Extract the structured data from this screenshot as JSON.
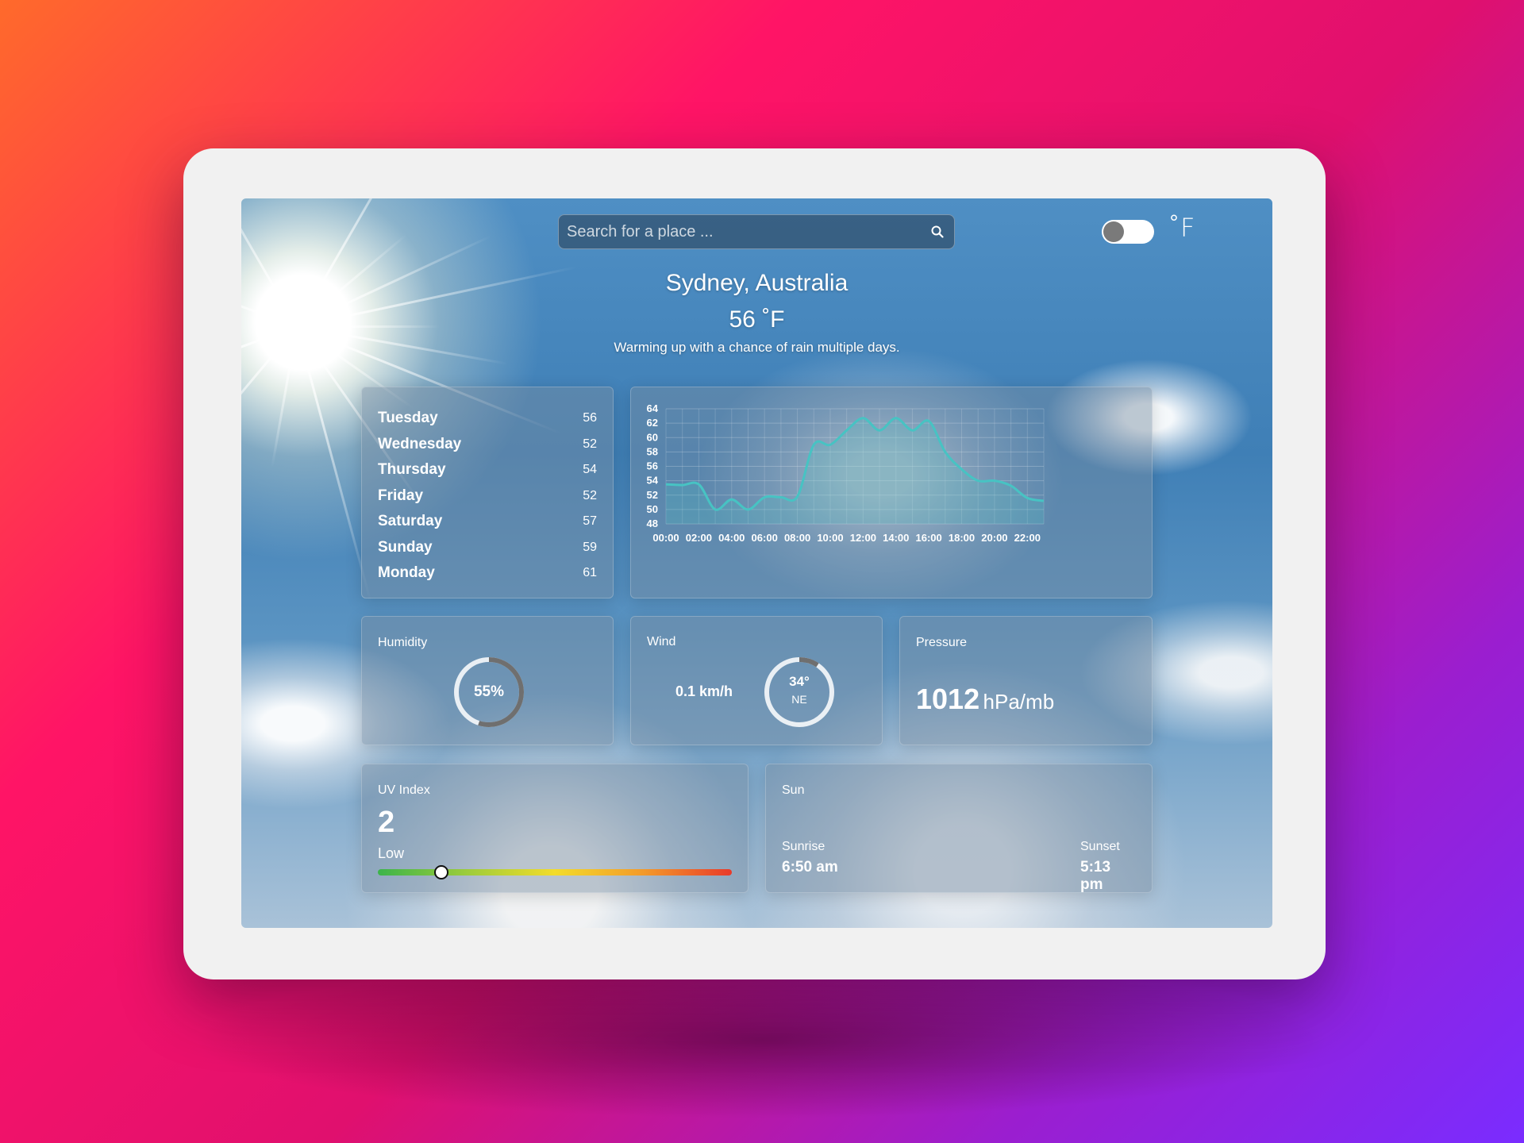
{
  "search": {
    "placeholder": "Search for a place ..."
  },
  "units": {
    "label": "˚F",
    "toggle_on": false
  },
  "location": {
    "city": "Sydney, Australia",
    "temp": "56",
    "temp_unit": "˚F",
    "description": "Warming up with a chance of rain multiple days."
  },
  "forecast": [
    {
      "day": "Tuesday",
      "temp": "56"
    },
    {
      "day": "Wednesday",
      "temp": "52"
    },
    {
      "day": "Thursday",
      "temp": "54"
    },
    {
      "day": "Friday",
      "temp": "52"
    },
    {
      "day": "Saturday",
      "temp": "57"
    },
    {
      "day": "Sunday",
      "temp": "59"
    },
    {
      "day": "Monday",
      "temp": "61"
    }
  ],
  "chart_data": {
    "type": "area",
    "x": [
      "00:00",
      "01:00",
      "02:00",
      "03:00",
      "04:00",
      "05:00",
      "06:00",
      "07:00",
      "08:00",
      "09:00",
      "10:00",
      "11:00",
      "12:00",
      "13:00",
      "14:00",
      "15:00",
      "16:00",
      "17:00",
      "18:00",
      "19:00",
      "20:00",
      "21:00",
      "22:00",
      "23:00"
    ],
    "x_ticks": [
      "00:00",
      "02:00",
      "04:00",
      "06:00",
      "08:00",
      "10:00",
      "12:00",
      "14:00",
      "16:00",
      "18:00",
      "20:00",
      "22:00"
    ],
    "values": [
      53.5,
      53.4,
      53.5,
      50,
      51.4,
      50,
      51.7,
      51.7,
      51.8,
      59,
      59,
      61,
      62.7,
      61,
      62.7,
      61,
      62.3,
      58,
      55.6,
      54,
      54,
      53.3,
      51.6,
      51.2
    ],
    "ylim": [
      48,
      64
    ],
    "y_ticks": [
      48,
      50,
      52,
      54,
      56,
      58,
      60,
      62,
      64
    ],
    "grid": true,
    "line_color": "#47c3c3",
    "fill_color": "#47c3c3"
  },
  "humidity": {
    "label": "Humidity",
    "value": "55%",
    "fraction": 0.55
  },
  "wind": {
    "label": "Wind",
    "speed": "0.1 km/h",
    "degrees": "34°",
    "direction": "NE",
    "deg_value": 34
  },
  "pressure": {
    "label": "Pressure",
    "value": "1012",
    "unit": "hPa/mb"
  },
  "uv": {
    "label": "UV Index",
    "value": "2",
    "level": "Low",
    "fraction": 0.18
  },
  "sun": {
    "label": "Sun",
    "sunrise_label": "Sunrise",
    "sunrise": "6:50 am",
    "sunset_label": "Sunset",
    "sunset": "5:13 pm"
  }
}
